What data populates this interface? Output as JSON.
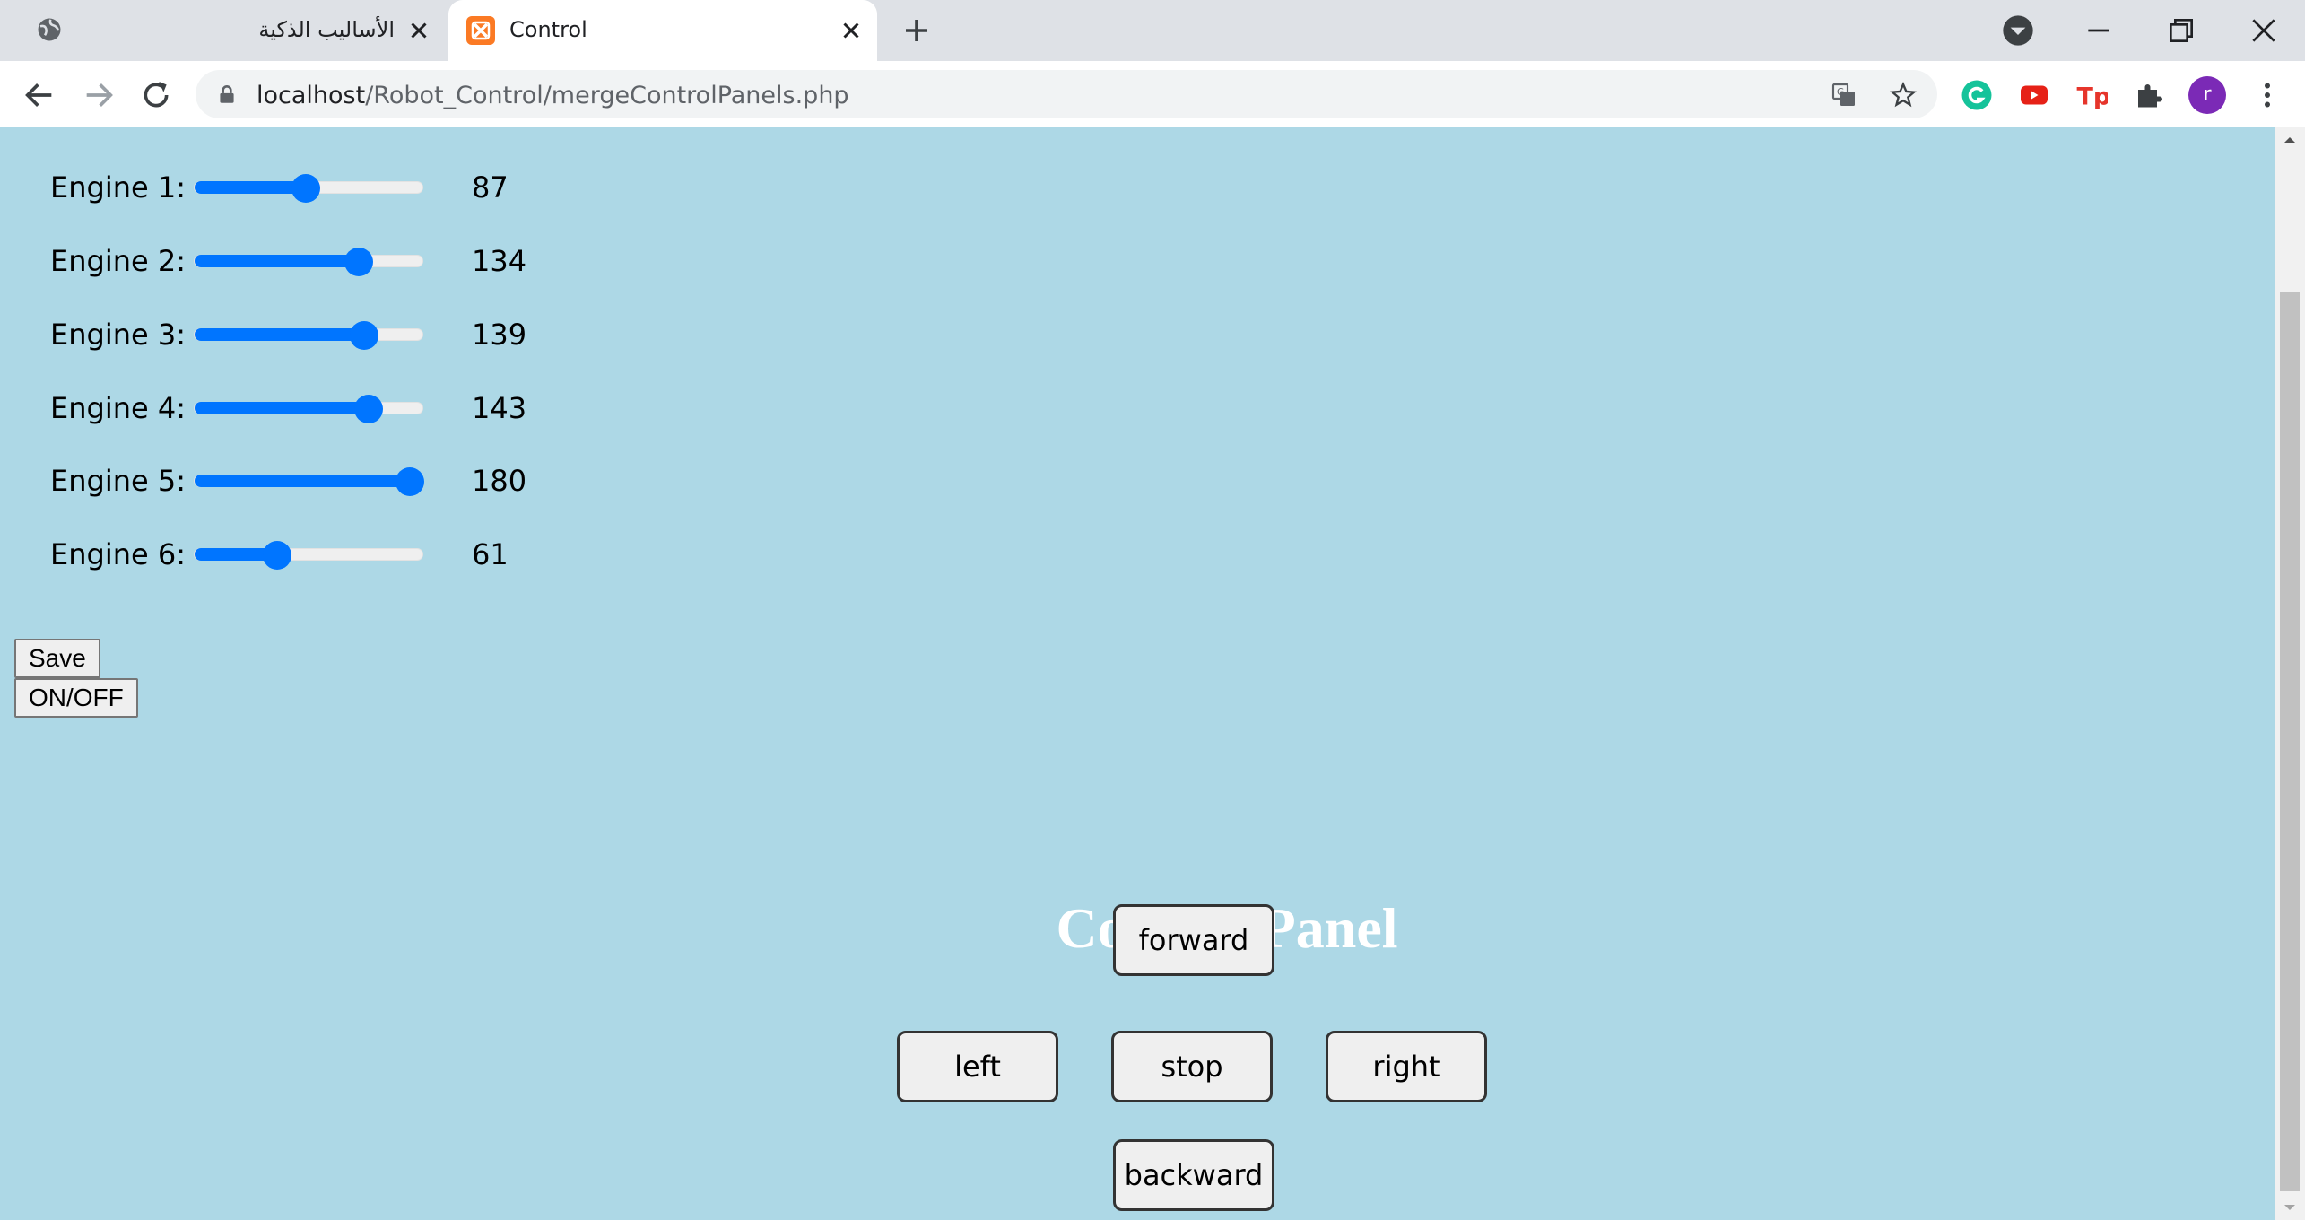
{
  "browser": {
    "tabs": [
      {
        "title": "الأساليب الذكية",
        "active": false
      },
      {
        "title": "Control",
        "active": true
      }
    ],
    "url_host": "localhost",
    "url_path": "/Robot_Control/mergeControlPanels.php",
    "profile_initial": "r"
  },
  "engines": [
    {
      "label": "Engine 1:",
      "value": "87",
      "fraction": 0.483
    },
    {
      "label": "Engine 2:",
      "value": "134",
      "fraction": 0.744
    },
    {
      "label": "Engine 3:",
      "value": "139",
      "fraction": 0.772
    },
    {
      "label": "Engine 4:",
      "value": "143",
      "fraction": 0.794
    },
    {
      "label": "Engine 5:",
      "value": "180",
      "fraction": 1.0
    },
    {
      "label": "Engine 6:",
      "value": "61",
      "fraction": 0.339
    }
  ],
  "buttons": {
    "save": "Save",
    "onoff": "ON/OFF"
  },
  "control_panel": {
    "title": "Control Panel",
    "forward": "forward",
    "left": "left",
    "stop": "stop",
    "right": "right",
    "backward": "backward"
  },
  "colors": {
    "page_background": "#add8e6",
    "slider_accent": "#0075ff"
  }
}
